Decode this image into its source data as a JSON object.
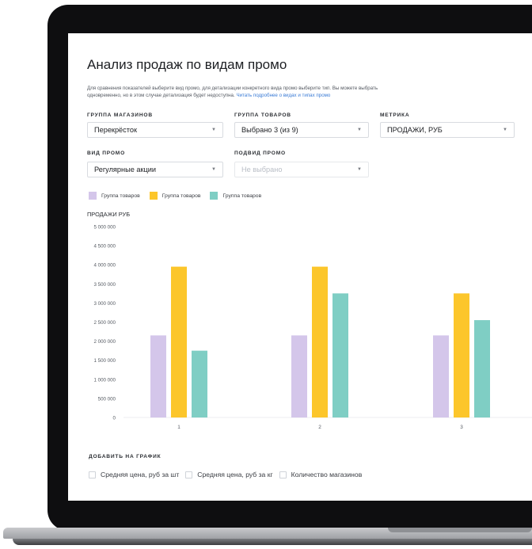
{
  "page": {
    "title": "Анализ продаж по видам промо",
    "description_line1": "Для сравнения показателей выберите вид промо, для детализации конкретного вида промо выберите тип. Вы можете выбрать",
    "description_line2": "одновременно, но в этом случае детализация будет недоступна.",
    "description_link": "Читать подробнее о видах и типах промо"
  },
  "filters": {
    "store_group": {
      "label": "ГРУППА МАГАЗИНОВ",
      "value": "Перекрёсток"
    },
    "product_group": {
      "label": "ГРУППА ТОВАРОВ",
      "value": "Выбрано 3 (из 9)"
    },
    "metric": {
      "label": "МЕТРИКА",
      "value": "ПРОДАЖИ, РУБ"
    },
    "promo_type": {
      "label": "ВИД ПРОМО",
      "value": "Регулярные акции"
    },
    "promo_subtype": {
      "label": "ПОДВИД ПРОМО",
      "placeholder": "Не выбрано"
    }
  },
  "legend": [
    {
      "label": "Группа товаров",
      "color": "#d4c6ea"
    },
    {
      "label": "Группа товаров",
      "color": "#fcc62b"
    },
    {
      "label": "Группа товаров",
      "color": "#7fcec4"
    }
  ],
  "chart_data": {
    "type": "bar",
    "ylabel": "ПРОДАЖИ РУБ",
    "categories": [
      "1",
      "2",
      "3"
    ],
    "ylim": [
      0,
      5000000
    ],
    "yticks": [
      "0",
      "500 000",
      "1 000 000",
      "1 500 000",
      "2 000 000",
      "2 500 000",
      "3 000 000",
      "3 500 000",
      "4 000 000",
      "4 500 000",
      "5 000 000"
    ],
    "series": [
      {
        "name": "Группа товаров",
        "color": "#d4c6ea",
        "values": [
          2150000,
          2150000,
          2150000
        ]
      },
      {
        "name": "Группа товаров",
        "color": "#fcc62b",
        "values": [
          3950000,
          3950000,
          3250000
        ]
      },
      {
        "name": "Группа товаров",
        "color": "#7fcec4",
        "values": [
          1750000,
          3250000,
          2550000
        ]
      }
    ]
  },
  "add_to_chart": {
    "label": "ДОБАВИТЬ НА ГРАФИК",
    "options": [
      "Средняя цена, руб за шт",
      "Средняя цена, руб за кг",
      "Количество магазинов"
    ]
  }
}
